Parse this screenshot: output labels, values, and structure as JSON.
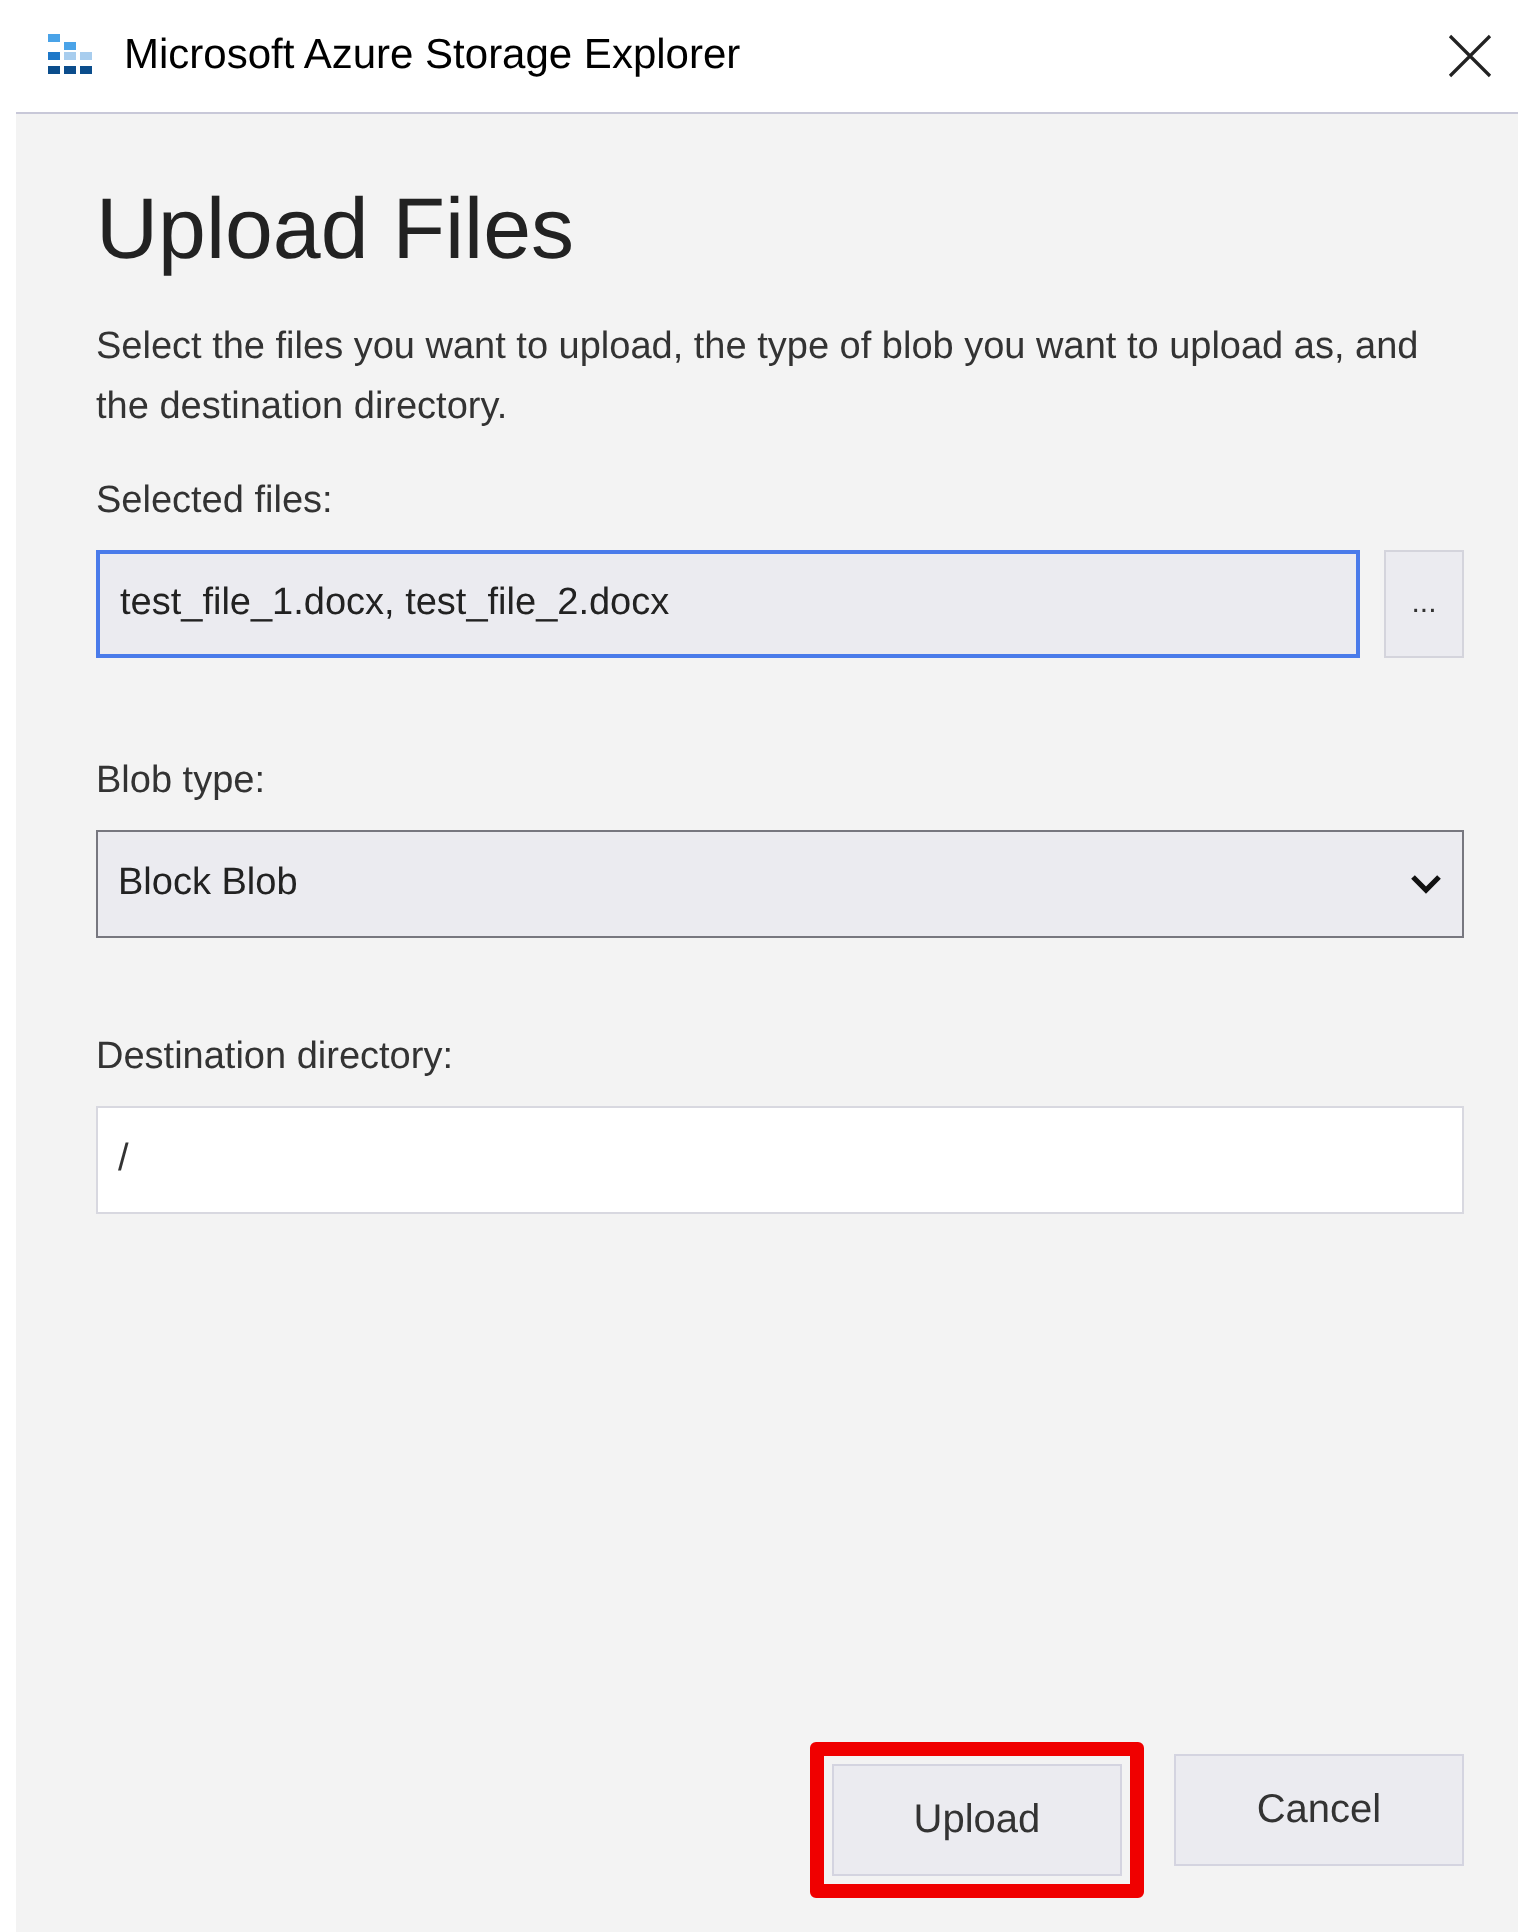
{
  "window": {
    "title": "Microsoft Azure Storage Explorer"
  },
  "heading": "Upload Files",
  "description": "Select the files you want to upload, the type of blob you want to upload as, and the destination directory.",
  "selected_files": {
    "label": "Selected files:",
    "value": "test_file_1.docx, test_file_2.docx",
    "focused": true,
    "browse_button": "..."
  },
  "blob_type": {
    "label": "Blob type:",
    "value": "Block Blob"
  },
  "destination_directory": {
    "label": "Destination directory:",
    "value": "/",
    "focused": false
  },
  "buttons": [
    {
      "label": "Upload",
      "highlighted": true
    },
    {
      "label": "Cancel",
      "highlighted": false
    }
  ]
}
